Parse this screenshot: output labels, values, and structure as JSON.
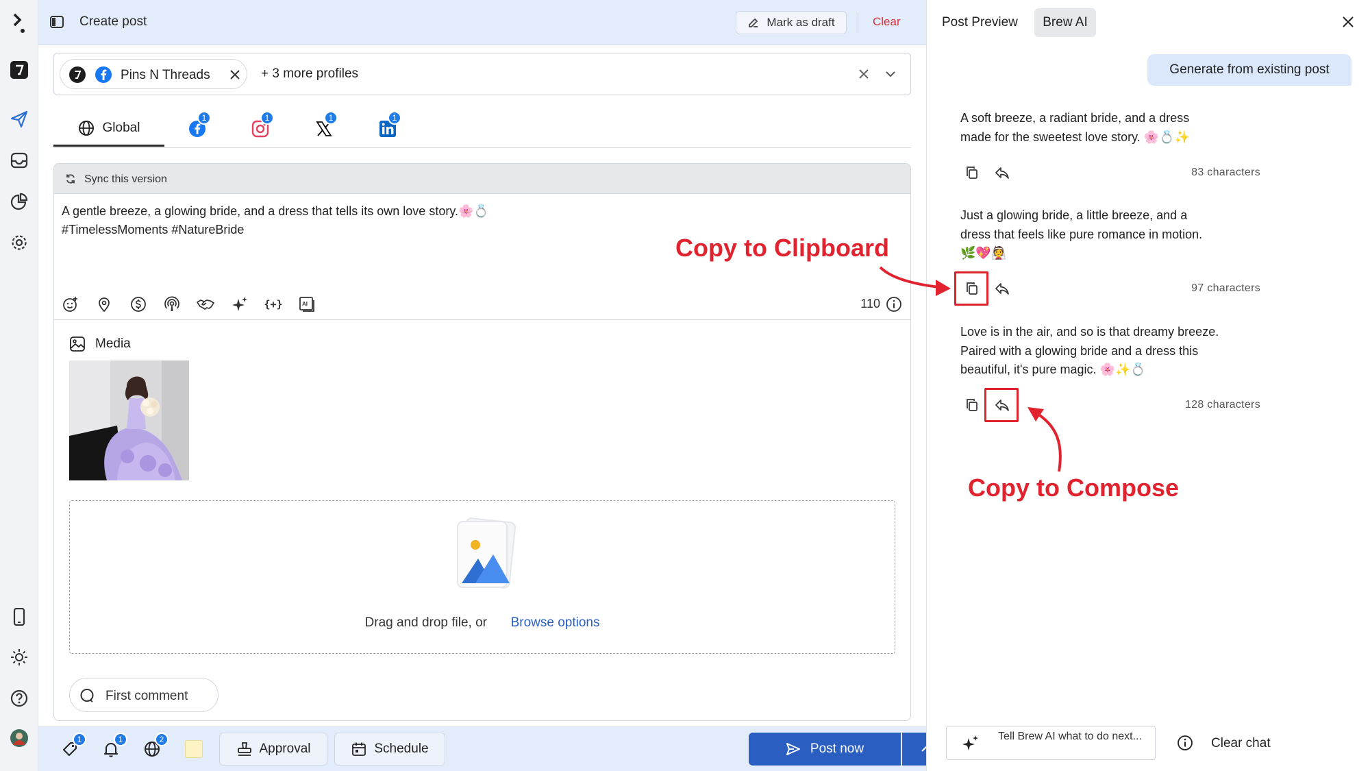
{
  "topbar": {
    "title": "Create post",
    "mark_draft_label": "Mark as draft",
    "clear_label": "Clear"
  },
  "profiles": {
    "selected_profile": "Pins N Threads",
    "more_profiles": "+ 3 more profiles"
  },
  "tabs": {
    "global_label": "Global",
    "network_badges": [
      "1",
      "1",
      "1",
      "1"
    ]
  },
  "editor": {
    "sync_label": "Sync this version",
    "post_lines": [
      "A gentle breeze, a glowing bride, and a dress that tells its own love story.🌸💍",
      "#TimelessMoments #NatureBride"
    ],
    "char_count": "110",
    "media_label": "Media",
    "drop_text": "Drag and drop file, or",
    "browse_label": "Browse options",
    "first_comment_label": "First comment"
  },
  "bottombar": {
    "badges": [
      "1",
      "1",
      "2"
    ],
    "approval_label": "Approval",
    "schedule_label": "Schedule",
    "post_now_label": "Post now"
  },
  "right_panel": {
    "tab_preview": "Post Preview",
    "tab_brew": "Brew AI",
    "generate_label": "Generate from existing post",
    "suggestions": [
      {
        "lines": [
          "A soft breeze, a radiant bride, and a dress",
          "made for the sweetest love story. 🌸💍✨"
        ],
        "count": "83 characters"
      },
      {
        "lines": [
          "Just a glowing bride, a little breeze, and a",
          "dress that feels like pure romance in motion.",
          "🌿💖👰"
        ],
        "count": "97 characters"
      },
      {
        "lines": [
          "Love is in the air, and so is that dreamy breeze.",
          "Paired with a glowing bride and a dress this",
          "beautiful, it's pure magic. 🌸✨💍"
        ],
        "count": "128 characters"
      }
    ],
    "annotation_clipboard": "Copy to Clipboard",
    "annotation_compose": "Copy to Compose",
    "brew_input_placeholder": "Tell Brew AI what to do next...",
    "clear_chat_label": "Clear chat"
  },
  "colors": {
    "accent_blue": "#2a5fc1",
    "topbar_bg": "#e2ecfb",
    "annotation_red": "#e1232f",
    "clear_red": "#d2343c",
    "facebook": "#1877f2",
    "instagram": "#e4405f",
    "linkedin": "#0a66c2"
  },
  "icons": [
    "app-logo-icon",
    "calendar-icon",
    "send-icon",
    "inbox-icon",
    "analytics-icon",
    "settings-icon",
    "mobile-icon",
    "theme-icon",
    "help-icon",
    "user-avatar",
    "sidebar-toggle-icon",
    "draft-icon",
    "globe-icon",
    "facebook-icon",
    "instagram-icon",
    "x-icon",
    "linkedin-icon",
    "sync-icon",
    "emoji-icon",
    "location-icon",
    "dollar-icon",
    "podcast-icon",
    "handshake-icon",
    "sparkle-icon",
    "variables-icon",
    "ai-image-icon",
    "info-icon",
    "media-icon",
    "upload-illustration",
    "comment-icon",
    "tag-icon",
    "bell-icon",
    "stamp-icon",
    "calendar-icon",
    "copy-icon",
    "reply-icon",
    "close-icon",
    "chevron-down-icon",
    "chevron-up-icon"
  ]
}
